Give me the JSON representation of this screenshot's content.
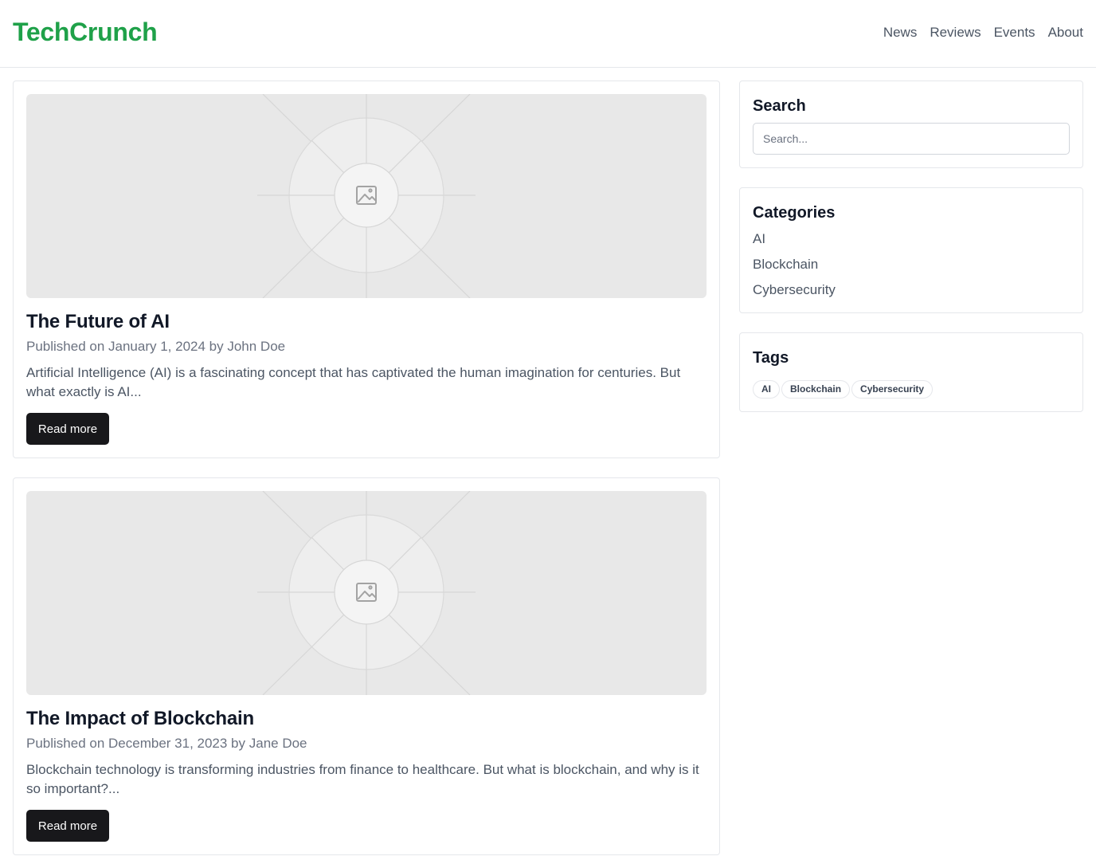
{
  "header": {
    "brand": "TechCrunch",
    "brand_color": "#1fa149",
    "nav": [
      "News",
      "Reviews",
      "Events",
      "About"
    ]
  },
  "posts": [
    {
      "title": "The Future of AI",
      "meta": "Published on January 1, 2024 by John Doe",
      "excerpt": "Artificial Intelligence (AI) is a fascinating concept that has captivated the human imagination for centuries. But what exactly is AI...",
      "button": "Read more",
      "thumbnail_icon": "image-placeholder-icon"
    },
    {
      "title": "The Impact of Blockchain",
      "meta": "Published on December 31, 2023 by Jane Doe",
      "excerpt": "Blockchain technology is transforming industries from finance to healthcare. But what is blockchain, and why is it so important?...",
      "button": "Read more",
      "thumbnail_icon": "image-placeholder-icon"
    }
  ],
  "sidebar": {
    "search": {
      "title": "Search",
      "placeholder": "Search..."
    },
    "categories": {
      "title": "Categories",
      "items": [
        "AI",
        "Blockchain",
        "Cybersecurity"
      ]
    },
    "tags": {
      "title": "Tags",
      "items": [
        "AI",
        "Blockchain",
        "Cybersecurity"
      ]
    }
  }
}
